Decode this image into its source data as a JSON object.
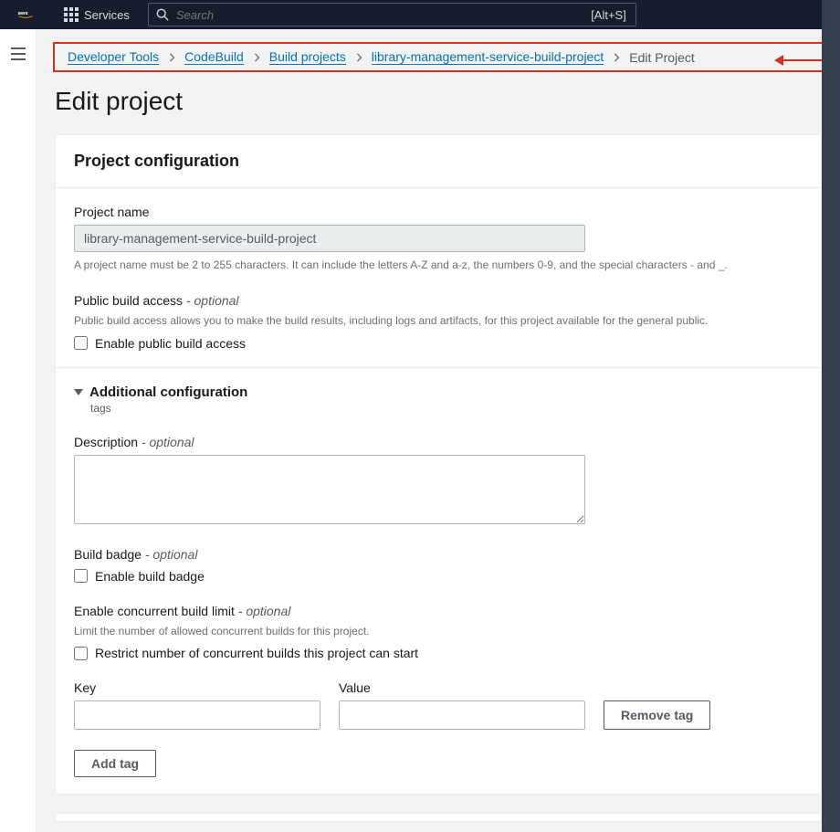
{
  "topnav": {
    "logo_text": "aws",
    "services_label": "Services",
    "search_placeholder": "Search",
    "search_shortcut": "[Alt+S]"
  },
  "breadcrumb": {
    "items": [
      {
        "label": "Developer Tools"
      },
      {
        "label": "CodeBuild"
      },
      {
        "label": "Build projects"
      },
      {
        "label": "library-management-service-build-project"
      }
    ],
    "current": "Edit Project"
  },
  "page": {
    "title": "Edit project"
  },
  "panel": {
    "header": "Project configuration",
    "project_name": {
      "label": "Project name",
      "value": "library-management-service-build-project",
      "hint": "A project name must be 2 to 255 characters. It can include the letters A-Z and a-z, the numbers 0-9, and the special characters - and _."
    },
    "public_access": {
      "label": "Public build access",
      "optional": "- optional",
      "hint": "Public build access allows you to make the build results, including logs and artifacts, for this project available for the general public.",
      "checkbox_label": "Enable public build access"
    },
    "additional": {
      "header": "Additional configuration",
      "sub": "tags",
      "description": {
        "label": "Description",
        "optional": "- optional"
      },
      "build_badge": {
        "label": "Build badge",
        "optional": "- optional",
        "checkbox_label": "Enable build badge"
      },
      "concurrent": {
        "label": "Enable concurrent build limit",
        "optional": "- optional",
        "hint": "Limit the number of allowed concurrent builds for this project.",
        "checkbox_label": "Restrict number of concurrent builds this project can start"
      },
      "tags": {
        "key_label": "Key",
        "value_label": "Value",
        "remove_btn": "Remove tag",
        "add_btn": "Add tag"
      }
    }
  }
}
